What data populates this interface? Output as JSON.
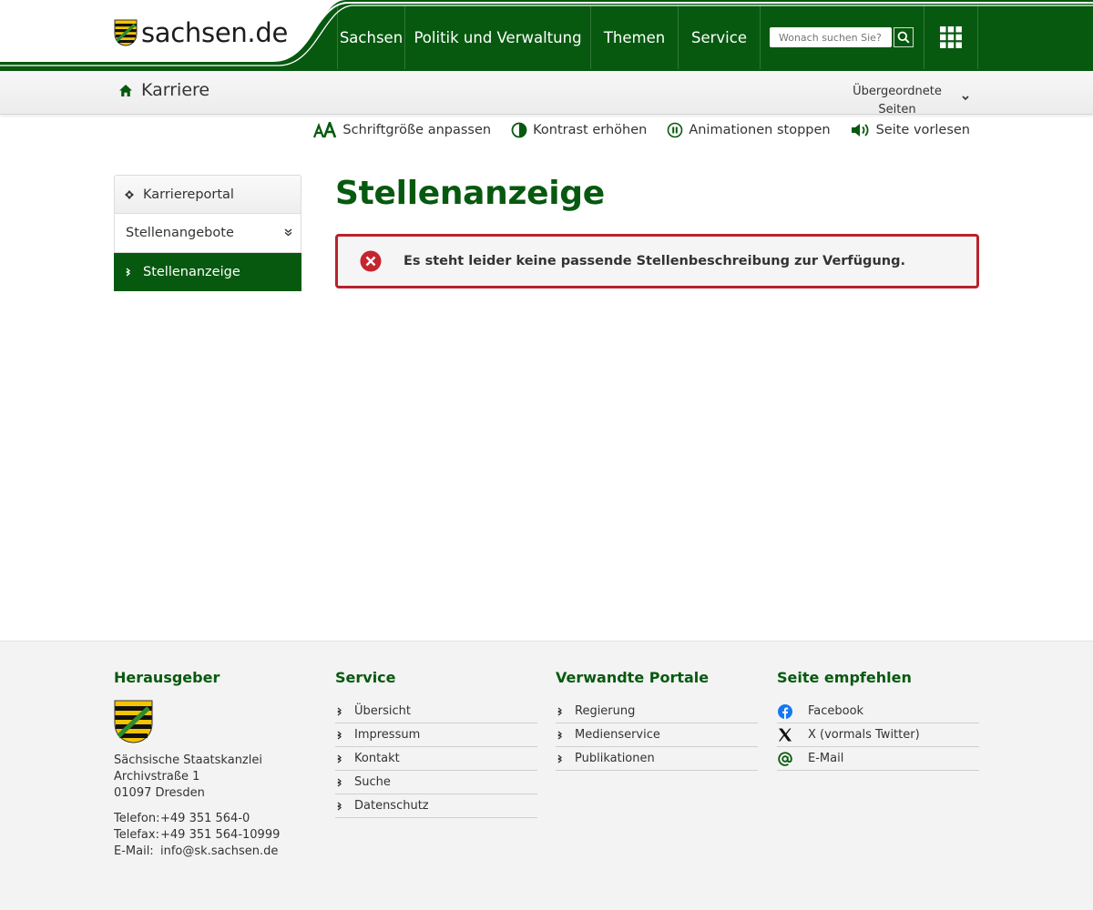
{
  "header": {
    "logo_text": "sachsen.de",
    "nav": [
      "Sachsen",
      "Politik und Verwaltung",
      "Themen",
      "Service"
    ],
    "search_placeholder": "Wonach suchen Sie?",
    "brand_green": "#07590f"
  },
  "subheader": {
    "title": "Karriere",
    "parent_pages": "Übergeordnete Seiten"
  },
  "a11y": {
    "font_size": "Schriftgröße anpassen",
    "contrast": "Kontrast erhöhen",
    "animations": "Animationen stoppen",
    "read_aloud": "Seite vorlesen"
  },
  "leftnav": {
    "items": [
      "Karriereportal",
      "Stellenangebote",
      "Stellenanzeige"
    ]
  },
  "main": {
    "title": "Stellenanzeige",
    "alert": "Es steht leider keine passende Stellenbeschreibung zur Verfügung.",
    "alert_color": "#b9222c"
  },
  "footer": {
    "publisher": {
      "heading": "Herausgeber",
      "org": "Sächsische Staatskanzlei",
      "street": "Archivstraße 1",
      "city": "01097 Dresden",
      "phone_label": "Telefon:",
      "phone": "+49 351 564-0",
      "fax_label": "Telefax:",
      "fax": "+49 351 564-10999",
      "email_label": "E-Mail:",
      "email": "info@sk.sachsen.de"
    },
    "service": {
      "heading": "Service",
      "items": [
        "Übersicht",
        "Impressum",
        "Kontakt",
        "Suche",
        "Datenschutz"
      ]
    },
    "portals": {
      "heading": "Verwandte Portale",
      "items": [
        "Regierung",
        "Medienservice",
        "Publikationen"
      ]
    },
    "share": {
      "heading": "Seite empfehlen",
      "items": [
        "Facebook",
        "X (vormals Twitter)",
        "E-Mail"
      ],
      "icons": [
        "facebook-icon",
        "x-icon",
        "at-icon"
      ]
    }
  }
}
